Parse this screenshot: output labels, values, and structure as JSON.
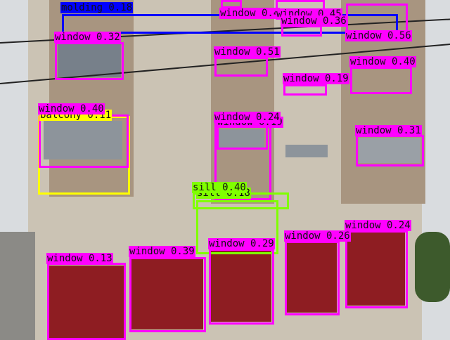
{
  "colors": {
    "window": "#ff00ff",
    "molding": "#0000ff",
    "balcony": "#ffff00",
    "sill": "#80ff00"
  },
  "detections": [
    {
      "cls": "molding",
      "label": "molding 0.18"
    },
    {
      "cls": "window",
      "label": "window 0.4"
    },
    {
      "cls": "window",
      "label": "window 0.45"
    },
    {
      "cls": "window",
      "label": "window 0.36"
    },
    {
      "cls": "window",
      "label": "window 0.56"
    },
    {
      "cls": "window",
      "label": "window 0.32"
    },
    {
      "cls": "window",
      "label": "window 0.51"
    },
    {
      "cls": "window",
      "label": "window 0.40"
    },
    {
      "cls": "window",
      "label": "window 0.19"
    },
    {
      "cls": "balcony",
      "label": "balcony 0.11"
    },
    {
      "cls": "window",
      "label": "window 0.40"
    },
    {
      "cls": "window",
      "label": "window 0.19"
    },
    {
      "cls": "window",
      "label": "window 0.24"
    },
    {
      "cls": "window",
      "label": "window 0.31"
    },
    {
      "cls": "sill",
      "label": "sill 0.18"
    },
    {
      "cls": "sill",
      "label": "sill 0.40"
    },
    {
      "cls": "window",
      "label": "window 0.13"
    },
    {
      "cls": "window",
      "label": "window 0.39"
    },
    {
      "cls": "window",
      "label": "window 0.29"
    },
    {
      "cls": "window",
      "label": "window 0.26"
    },
    {
      "cls": "window",
      "label": "window 0.24"
    }
  ]
}
